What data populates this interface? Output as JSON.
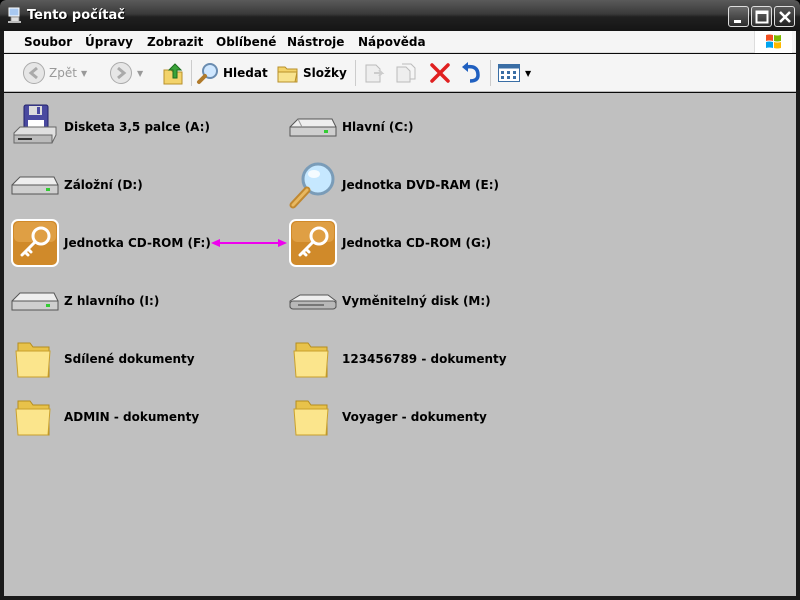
{
  "window": {
    "title": "Tento počítač"
  },
  "menu": [
    "Soubor",
    "Úpravy",
    "Zobrazit",
    "Oblíbené",
    "Nástroje",
    "Nápověda"
  ],
  "toolbar": {
    "back": "Zpět",
    "search": "Hledat",
    "folders": "Složky"
  },
  "items": [
    {
      "label": "Disketa 3,5 palce (A:)",
      "icon": "floppy-drive-icon"
    },
    {
      "label": "Hlavní (C:)",
      "icon": "hard-drive-icon"
    },
    {
      "label": "Záložní (D:)",
      "icon": "hard-drive-icon"
    },
    {
      "label": "Jednotka DVD-RAM (E:)",
      "icon": "magnifier-icon"
    },
    {
      "label": "Jednotka CD-ROM (F:)",
      "icon": "key-icon"
    },
    {
      "label": "Jednotka CD-ROM (G:)",
      "icon": "key-icon"
    },
    {
      "label": "Z hlavního (I:)",
      "icon": "hard-drive-icon"
    },
    {
      "label": "Vyměnitelný disk (M:)",
      "icon": "removable-disk-icon"
    },
    {
      "label": "Sdílené dokumenty",
      "icon": "folder-icon"
    },
    {
      "label": "123456789 - dokumenty",
      "icon": "folder-icon"
    },
    {
      "label": "ADMIN - dokumenty",
      "icon": "folder-icon"
    },
    {
      "label": "Voyager - dokumenty",
      "icon": "folder-icon"
    }
  ],
  "colors": {
    "content_bg": "#c0c0c0",
    "annotation_arrow": "#ee00ee"
  }
}
